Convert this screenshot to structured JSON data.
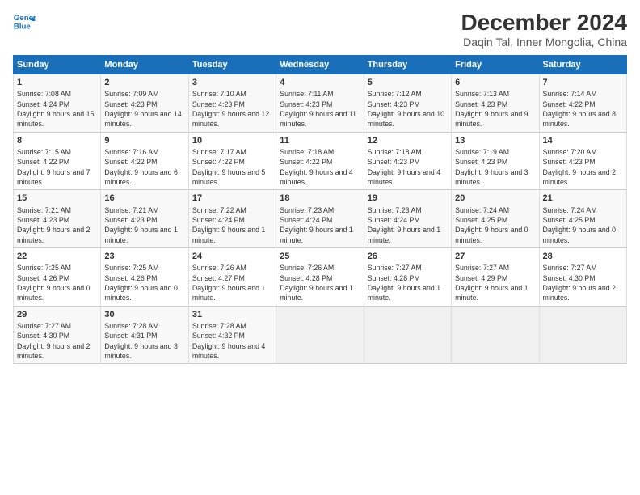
{
  "header": {
    "logo_line1": "General",
    "logo_line2": "Blue",
    "title": "December 2024",
    "subtitle": "Daqin Tal, Inner Mongolia, China"
  },
  "weekdays": [
    "Sunday",
    "Monday",
    "Tuesday",
    "Wednesday",
    "Thursday",
    "Friday",
    "Saturday"
  ],
  "weeks": [
    [
      {
        "day": "1",
        "sunrise": "Sunrise: 7:08 AM",
        "sunset": "Sunset: 4:24 PM",
        "daylight": "Daylight: 9 hours and 15 minutes."
      },
      {
        "day": "2",
        "sunrise": "Sunrise: 7:09 AM",
        "sunset": "Sunset: 4:23 PM",
        "daylight": "Daylight: 9 hours and 14 minutes."
      },
      {
        "day": "3",
        "sunrise": "Sunrise: 7:10 AM",
        "sunset": "Sunset: 4:23 PM",
        "daylight": "Daylight: 9 hours and 12 minutes."
      },
      {
        "day": "4",
        "sunrise": "Sunrise: 7:11 AM",
        "sunset": "Sunset: 4:23 PM",
        "daylight": "Daylight: 9 hours and 11 minutes."
      },
      {
        "day": "5",
        "sunrise": "Sunrise: 7:12 AM",
        "sunset": "Sunset: 4:23 PM",
        "daylight": "Daylight: 9 hours and 10 minutes."
      },
      {
        "day": "6",
        "sunrise": "Sunrise: 7:13 AM",
        "sunset": "Sunset: 4:23 PM",
        "daylight": "Daylight: 9 hours and 9 minutes."
      },
      {
        "day": "7",
        "sunrise": "Sunrise: 7:14 AM",
        "sunset": "Sunset: 4:22 PM",
        "daylight": "Daylight: 9 hours and 8 minutes."
      }
    ],
    [
      {
        "day": "8",
        "sunrise": "Sunrise: 7:15 AM",
        "sunset": "Sunset: 4:22 PM",
        "daylight": "Daylight: 9 hours and 7 minutes."
      },
      {
        "day": "9",
        "sunrise": "Sunrise: 7:16 AM",
        "sunset": "Sunset: 4:22 PM",
        "daylight": "Daylight: 9 hours and 6 minutes."
      },
      {
        "day": "10",
        "sunrise": "Sunrise: 7:17 AM",
        "sunset": "Sunset: 4:22 PM",
        "daylight": "Daylight: 9 hours and 5 minutes."
      },
      {
        "day": "11",
        "sunrise": "Sunrise: 7:18 AM",
        "sunset": "Sunset: 4:22 PM",
        "daylight": "Daylight: 9 hours and 4 minutes."
      },
      {
        "day": "12",
        "sunrise": "Sunrise: 7:18 AM",
        "sunset": "Sunset: 4:23 PM",
        "daylight": "Daylight: 9 hours and 4 minutes."
      },
      {
        "day": "13",
        "sunrise": "Sunrise: 7:19 AM",
        "sunset": "Sunset: 4:23 PM",
        "daylight": "Daylight: 9 hours and 3 minutes."
      },
      {
        "day": "14",
        "sunrise": "Sunrise: 7:20 AM",
        "sunset": "Sunset: 4:23 PM",
        "daylight": "Daylight: 9 hours and 2 minutes."
      }
    ],
    [
      {
        "day": "15",
        "sunrise": "Sunrise: 7:21 AM",
        "sunset": "Sunset: 4:23 PM",
        "daylight": "Daylight: 9 hours and 2 minutes."
      },
      {
        "day": "16",
        "sunrise": "Sunrise: 7:21 AM",
        "sunset": "Sunset: 4:23 PM",
        "daylight": "Daylight: 9 hours and 1 minute."
      },
      {
        "day": "17",
        "sunrise": "Sunrise: 7:22 AM",
        "sunset": "Sunset: 4:24 PM",
        "daylight": "Daylight: 9 hours and 1 minute."
      },
      {
        "day": "18",
        "sunrise": "Sunrise: 7:23 AM",
        "sunset": "Sunset: 4:24 PM",
        "daylight": "Daylight: 9 hours and 1 minute."
      },
      {
        "day": "19",
        "sunrise": "Sunrise: 7:23 AM",
        "sunset": "Sunset: 4:24 PM",
        "daylight": "Daylight: 9 hours and 1 minute."
      },
      {
        "day": "20",
        "sunrise": "Sunrise: 7:24 AM",
        "sunset": "Sunset: 4:25 PM",
        "daylight": "Daylight: 9 hours and 0 minutes."
      },
      {
        "day": "21",
        "sunrise": "Sunrise: 7:24 AM",
        "sunset": "Sunset: 4:25 PM",
        "daylight": "Daylight: 9 hours and 0 minutes."
      }
    ],
    [
      {
        "day": "22",
        "sunrise": "Sunrise: 7:25 AM",
        "sunset": "Sunset: 4:26 PM",
        "daylight": "Daylight: 9 hours and 0 minutes."
      },
      {
        "day": "23",
        "sunrise": "Sunrise: 7:25 AM",
        "sunset": "Sunset: 4:26 PM",
        "daylight": "Daylight: 9 hours and 0 minutes."
      },
      {
        "day": "24",
        "sunrise": "Sunrise: 7:26 AM",
        "sunset": "Sunset: 4:27 PM",
        "daylight": "Daylight: 9 hours and 1 minute."
      },
      {
        "day": "25",
        "sunrise": "Sunrise: 7:26 AM",
        "sunset": "Sunset: 4:28 PM",
        "daylight": "Daylight: 9 hours and 1 minute."
      },
      {
        "day": "26",
        "sunrise": "Sunrise: 7:27 AM",
        "sunset": "Sunset: 4:28 PM",
        "daylight": "Daylight: 9 hours and 1 minute."
      },
      {
        "day": "27",
        "sunrise": "Sunrise: 7:27 AM",
        "sunset": "Sunset: 4:29 PM",
        "daylight": "Daylight: 9 hours and 1 minute."
      },
      {
        "day": "28",
        "sunrise": "Sunrise: 7:27 AM",
        "sunset": "Sunset: 4:30 PM",
        "daylight": "Daylight: 9 hours and 2 minutes."
      }
    ],
    [
      {
        "day": "29",
        "sunrise": "Sunrise: 7:27 AM",
        "sunset": "Sunset: 4:30 PM",
        "daylight": "Daylight: 9 hours and 2 minutes."
      },
      {
        "day": "30",
        "sunrise": "Sunrise: 7:28 AM",
        "sunset": "Sunset: 4:31 PM",
        "daylight": "Daylight: 9 hours and 3 minutes."
      },
      {
        "day": "31",
        "sunrise": "Sunrise: 7:28 AM",
        "sunset": "Sunset: 4:32 PM",
        "daylight": "Daylight: 9 hours and 4 minutes."
      },
      null,
      null,
      null,
      null
    ]
  ]
}
